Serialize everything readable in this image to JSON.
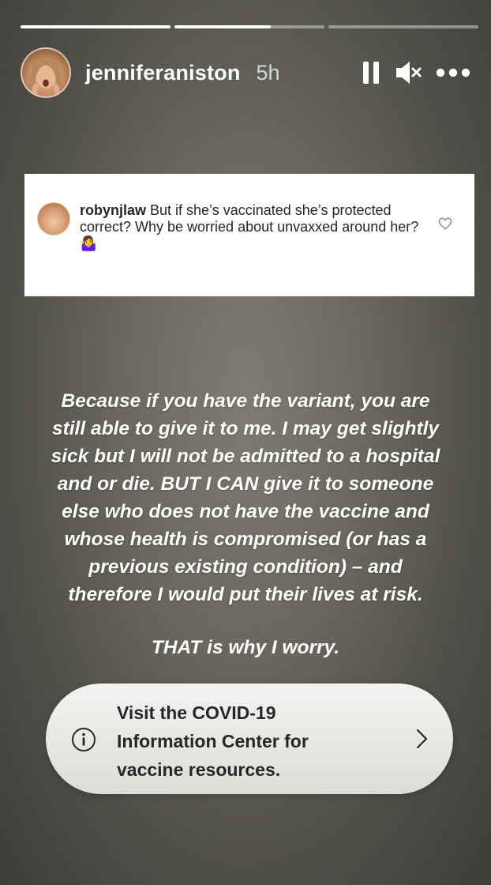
{
  "progress": [
    1.0,
    0.64,
    0.0
  ],
  "header": {
    "username": "jenniferaniston",
    "time": "5h",
    "icons": [
      "pause-icon",
      "mute-icon",
      "more-icon"
    ]
  },
  "comment": {
    "username": "robynjlaw",
    "text": " But if she’s vaccinated she’s protected correct? Why be worried about unvaxxed around her? ",
    "emoji": "🤷‍♀️"
  },
  "story_text": [
    "Because if you have the variant, you are",
    "still able to give it to me. I may get slightly",
    "sick but I will not be admitted to a hospital",
    "and or die. BUT I CAN give it to someone",
    "else who does not have the vaccine and",
    "whose health is compromised (or has a",
    "previous existing condition) – and",
    "therefore I would put their lives at risk."
  ],
  "story_closing": "THAT is why I worry.",
  "covid_banner": {
    "text": "Visit the COVID-19 Information Center for vaccine resources."
  }
}
